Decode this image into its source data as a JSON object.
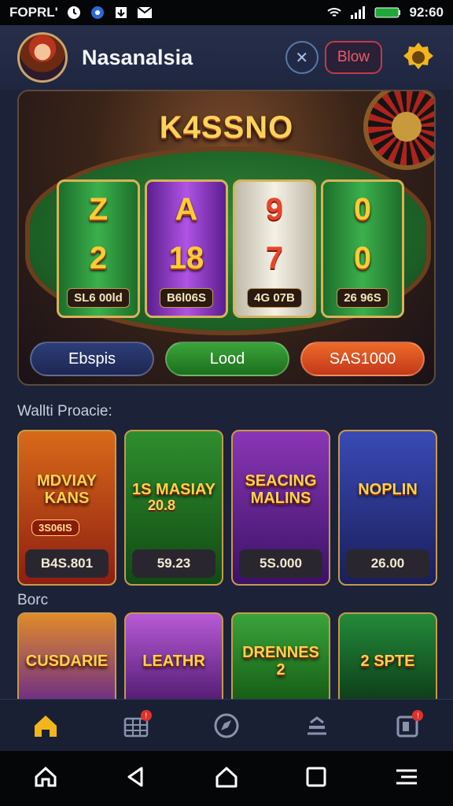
{
  "status_bar": {
    "carrier": "FOPRL'",
    "time": "92:60"
  },
  "header": {
    "app_name": "Nasanalsia",
    "button_label": "Blow"
  },
  "hero": {
    "title": "K4SSNO",
    "reels": [
      {
        "top": "Z",
        "bottom": "2",
        "value": "SL6 00ld"
      },
      {
        "top": "A",
        "bottom": "18",
        "value": "B6l06S"
      },
      {
        "top": "9",
        "bottom": "7",
        "value": "4G 07B"
      },
      {
        "top": "0",
        "bottom": "0",
        "value": "26 96S"
      }
    ],
    "buttons": [
      "Ebspis",
      "Lood",
      "SAS1000"
    ]
  },
  "section1": {
    "title": "Wallti Proacie:",
    "cards": [
      {
        "art": "MDVIAY KANS",
        "sub": "3S06IS",
        "price": "B4S.801"
      },
      {
        "art": "1S MASIAY",
        "sub": "20.8",
        "price": "59.23"
      },
      {
        "art": "SEACING MALINS",
        "sub": "",
        "price": "5S.000"
      },
      {
        "art": "NOPLIN",
        "sub": "",
        "price": "26.00"
      }
    ]
  },
  "section2": {
    "title": "Borc",
    "cards": [
      {
        "art": "CUSDARIE"
      },
      {
        "art": "LEATHR"
      },
      {
        "art": "DRENNES 2"
      },
      {
        "art": "2 SPTE"
      }
    ]
  },
  "colors": {
    "accent": "#ffd35a",
    "background": "#1c2238",
    "nav_active": "#f2b51c"
  },
  "icons": [
    "home-icon",
    "cashier-icon",
    "compass-icon",
    "dealer-icon",
    "wallet-icon"
  ]
}
